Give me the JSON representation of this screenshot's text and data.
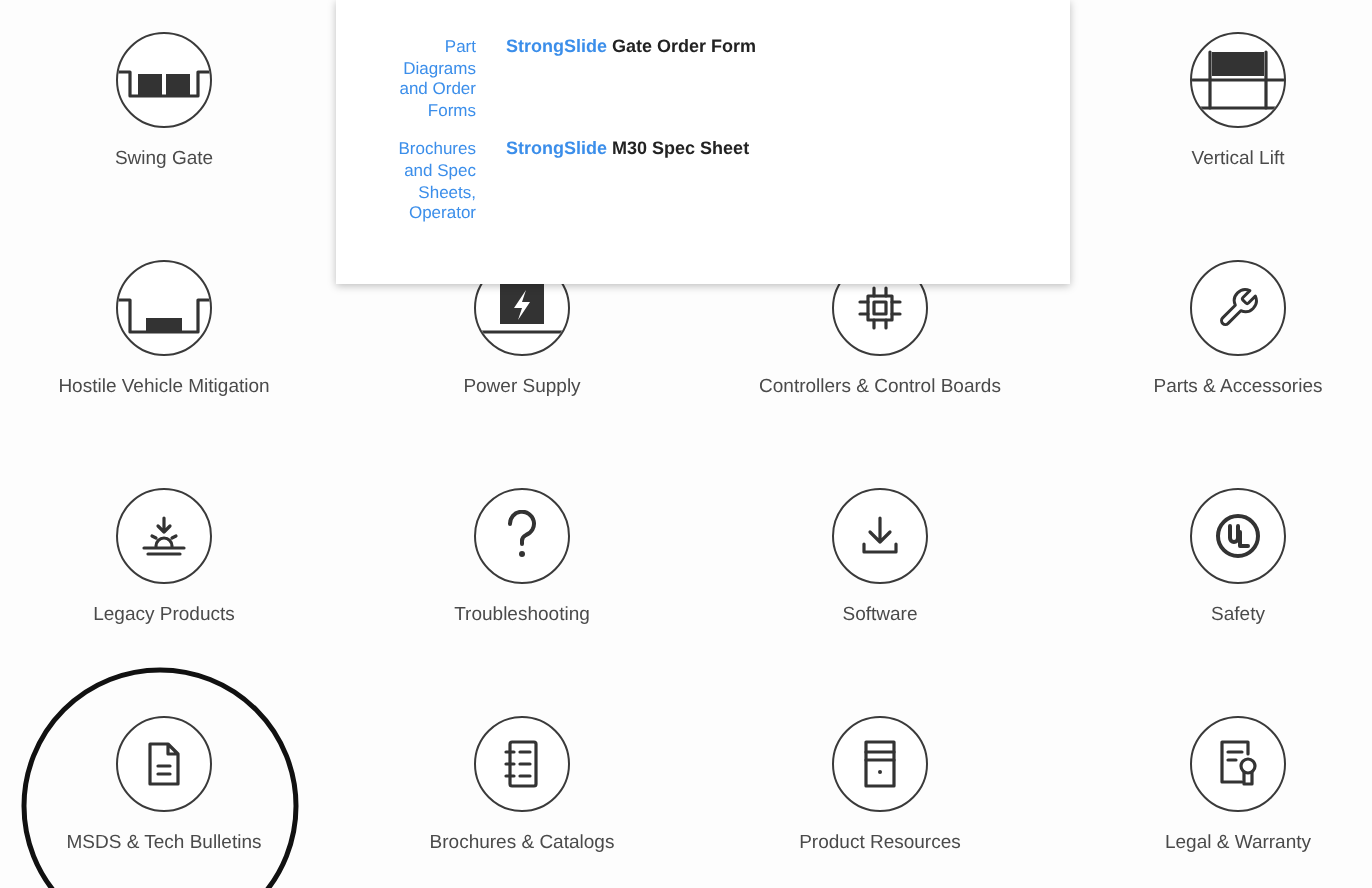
{
  "categories": [
    {
      "label": "Swing Gate",
      "circled": false
    },
    {
      "label": "Vertical Lift",
      "circled": false
    },
    {
      "label": "Hostile Vehicle Mitigation",
      "circled": false
    },
    {
      "label": "Power Supply",
      "circled": false
    },
    {
      "label": "Controllers & Control Boards",
      "circled": false
    },
    {
      "label": "Parts & Accessories",
      "circled": false
    },
    {
      "label": "Legacy Products",
      "circled": false
    },
    {
      "label": "Troubleshooting",
      "circled": false
    },
    {
      "label": "Software",
      "circled": false
    },
    {
      "label": "Safety",
      "circled": false
    },
    {
      "label": "MSDS & Tech Bulletins",
      "circled": true
    },
    {
      "label": "Brochures & Catalogs",
      "circled": false
    },
    {
      "label": "Product Resources",
      "circled": false
    },
    {
      "label": "Legal & Warranty",
      "circled": false
    }
  ],
  "popup": {
    "rows": [
      {
        "category": "Part Diagrams and Order Forms",
        "brand": "StrongSlide",
        "document": "Gate Order Form"
      },
      {
        "category": "Brochures and Spec Sheets, Operator",
        "brand": "StrongSlide",
        "document": "M30 Spec Sheet"
      }
    ]
  }
}
